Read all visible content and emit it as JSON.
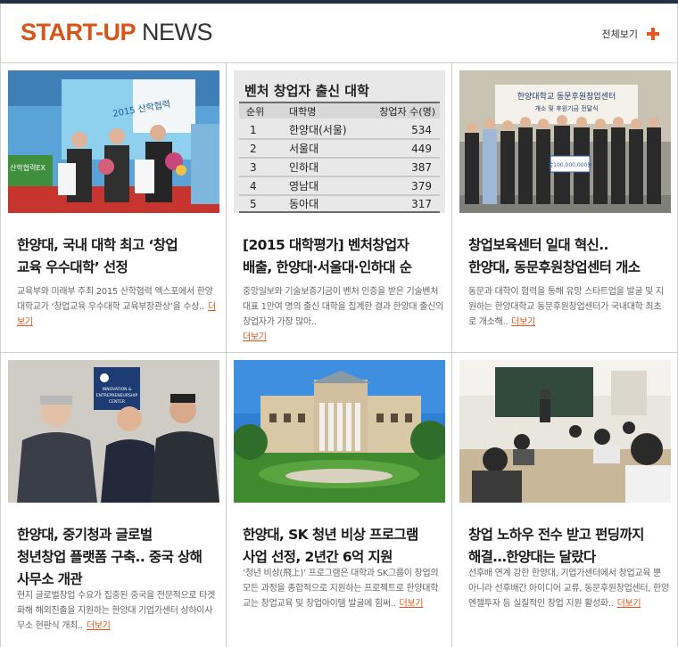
{
  "header": {
    "title_accent": "START-UP",
    "title_rest": "NEWS",
    "view_all": "전체보기"
  },
  "colors": {
    "accent": "#e2571d",
    "top_bar": "#223143"
  },
  "articles": [
    {
      "headline_line1": "한양대, 국내 대학 최고 ‘창업",
      "headline_line2": "교육 우수대학’ 선정",
      "headline_line3": "",
      "excerpt": "교육부와 미래부 주최 2015 산학협력 엑스포에서 한양대학교가 ‘창업교육 우수대학 교육부장관상’을 수상..",
      "more": "더보기",
      "image": {
        "booth_sign": "2015 산학협력",
        "side_sign": "산학협력EX"
      }
    },
    {
      "headline_line1": "[2015 대학평가] 벤처창업자",
      "headline_line2": "배출, 한양대·서울대·인하대 순",
      "headline_line3": "",
      "excerpt": "중앙일보와 기술보증기금이 벤처 인증을 받은 기술벤처 대표 1만여 명의 출신 대학을 집계한 결과 한양대 출신의 창업자가 가장 많아..",
      "more": "더보기",
      "image": {
        "table_title": "벤처 창업자 출신 대학",
        "columns": [
          "순위",
          "대학명",
          "창업자 수(명)"
        ],
        "rows": [
          [
            "1",
            "한양대(서울)",
            "534"
          ],
          [
            "2",
            "서울대",
            "449"
          ],
          [
            "3",
            "인하대",
            "387"
          ],
          [
            "4",
            "영남대",
            "379"
          ],
          [
            "5",
            "동아대",
            "317"
          ]
        ]
      }
    },
    {
      "headline_line1": "창업보육센터 일대 혁신..",
      "headline_line2": "한양대, 동문후원창업센터 개소",
      "headline_line3": "",
      "excerpt": "동문과 대학이 협력을 통해 유망 스타트업을 발굴 및 지원하는 한양대학교 동문후원창업센터가 국내대학 최초로 개소해..",
      "more": "더보기",
      "image": {
        "banner_line1": "한양대학교 동문후원창업센터",
        "banner_line2": "개소 및 후원기금 전달식",
        "check_amount": "金100,000,000원"
      }
    },
    {
      "headline_line1": "한양대, 중기청과 글로벌",
      "headline_line2": "청년창업 플랫폼 구축.. 중국 상해",
      "headline_line3": "사무소 개관",
      "excerpt": "현지 글로벌창업 수요가 집중된 중국을 전문적으로 타겟화해 해외진출을 지원하는 한양대 기업가센터 상하이사무소 현판식 개최..",
      "more": "더보기",
      "image": {
        "plaque_line1": "INNOVATION &",
        "plaque_line2": "ENTREPRENEURSHIP",
        "plaque_line3": "CENTER"
      }
    },
    {
      "headline_line1": "한양대, SK 청년 비상 프로그램",
      "headline_line2": "사업 선정, 2년간 6억 지원",
      "headline_line3": "",
      "excerpt": "‘청년 비상(飛上)’ 프로그램은 대학과 SK그룹이 창업의 모든 과정을 종합적으로 지원하는 프로젝트로 한양대학교는 창업교육 및 창업아이템 발굴에 힘써..",
      "more": "더보기",
      "image": {}
    },
    {
      "headline_line1": "창업 노하우 전수 받고 펀딩까지",
      "headline_line2": "해결…한양대는 달랐다",
      "headline_line3": "",
      "excerpt": "선후배 연계 강한 한양대, 기업가센터에서 창업교육 뿐 아니라 선후배간 아이디어 교류, 동문후원창업센터, 한양엔젤투자 등 실질적인 창업 지원 활성화..",
      "more": "더보기",
      "image": {}
    }
  ]
}
